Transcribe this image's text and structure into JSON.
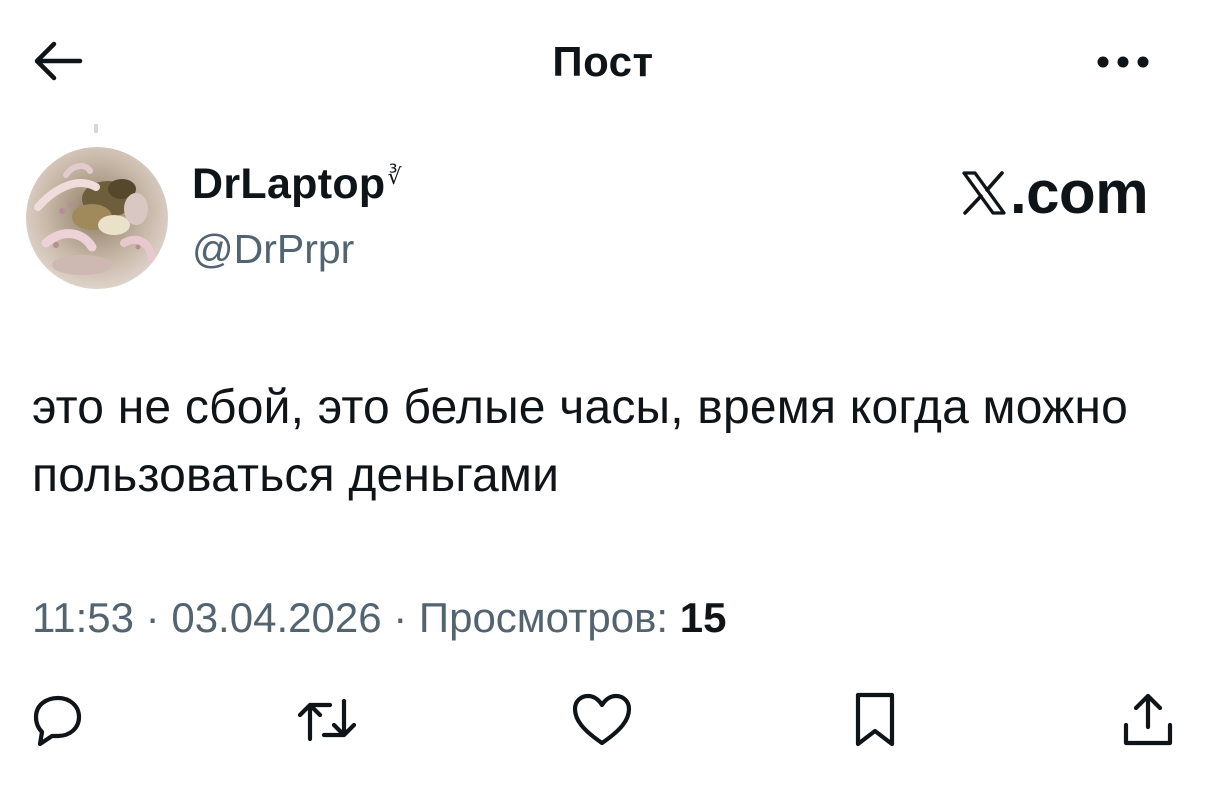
{
  "header": {
    "title": "Пост",
    "back_icon": "arrow-left-icon",
    "more_icon": "more-horizontal-icon"
  },
  "author": {
    "display_name": "DrLaptop",
    "badge": "∛",
    "handle": "@DrPrpr"
  },
  "watermark": {
    "logo": "x-logo-icon",
    "text": ".com"
  },
  "post": {
    "text": "это не сбой, это белые часы, время когда можно пользоваться деньгами",
    "time": "11:53",
    "separator": "·",
    "date": "03.04.2026",
    "views_label": "Просмотров:",
    "views_count": "15"
  },
  "actions": [
    {
      "name": "reply",
      "icon": "reply-icon"
    },
    {
      "name": "repost",
      "icon": "repost-icon"
    },
    {
      "name": "like",
      "icon": "heart-icon"
    },
    {
      "name": "bookmark",
      "icon": "bookmark-icon"
    },
    {
      "name": "share",
      "icon": "share-icon"
    }
  ],
  "colors": {
    "text_primary": "#0f1419",
    "text_secondary": "#536471",
    "background": "#ffffff"
  }
}
